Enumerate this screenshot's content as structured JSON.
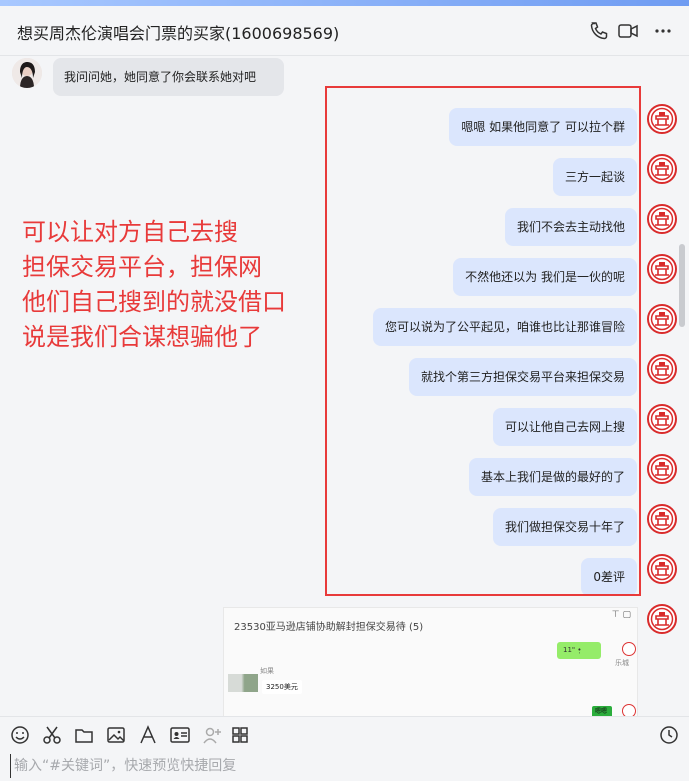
{
  "header": {
    "title": "想买周杰伦演唱会门票的买家(1600698569)"
  },
  "messages_incoming": [
    {
      "text": "我问问她，她同意了你会联系她对吧"
    }
  ],
  "messages_outgoing": [
    {
      "text": "嗯嗯 如果他同意了 可以拉个群"
    },
    {
      "text": "三方一起谈"
    },
    {
      "text": "我们不会去主动找他"
    },
    {
      "text": "不然他还以为  我们是一伙的呢"
    },
    {
      "text": "您可以说为了公平起见，咱谁也比让那谁冒险"
    },
    {
      "text": "就找个第三方担保交易平台来担保交易"
    },
    {
      "text": "可以让他自己去网上搜"
    },
    {
      "text": "基本上我们是做的最好的了"
    },
    {
      "text": "我们做担保交易十年了"
    },
    {
      "text": "0差评"
    }
  ],
  "annotation": {
    "lines": [
      "可以让对方自己去搜",
      "担保交易平台，担保网",
      "他们自己搜到的就没借口",
      "说是我们合谋想骗他了"
    ],
    "color": "#e83a3a"
  },
  "shared_card": {
    "title": "23530亚马逊店铺协助解封担保交易待 (5)",
    "icons": "⊤ ▢",
    "voice_label": "11\" •̩",
    "sender_name": "如果",
    "amount_text": "3250美元",
    "green_short": "嗯嗯",
    "avatar_caption": "乐城"
  },
  "toolbar": {
    "icons": [
      "emoji-icon",
      "scissors-icon",
      "folder-icon",
      "image-icon",
      "font-icon",
      "contact-card-icon",
      "add-user-icon",
      "apps-icon",
      "history-icon"
    ]
  },
  "input": {
    "placeholder": "输入“#关键词”，快速预览快捷回复",
    "value": ""
  },
  "colors": {
    "bubble_out": "#dbe6fd",
    "bubble_in": "#e4e6ea",
    "highlight_box": "#e83a3a"
  }
}
